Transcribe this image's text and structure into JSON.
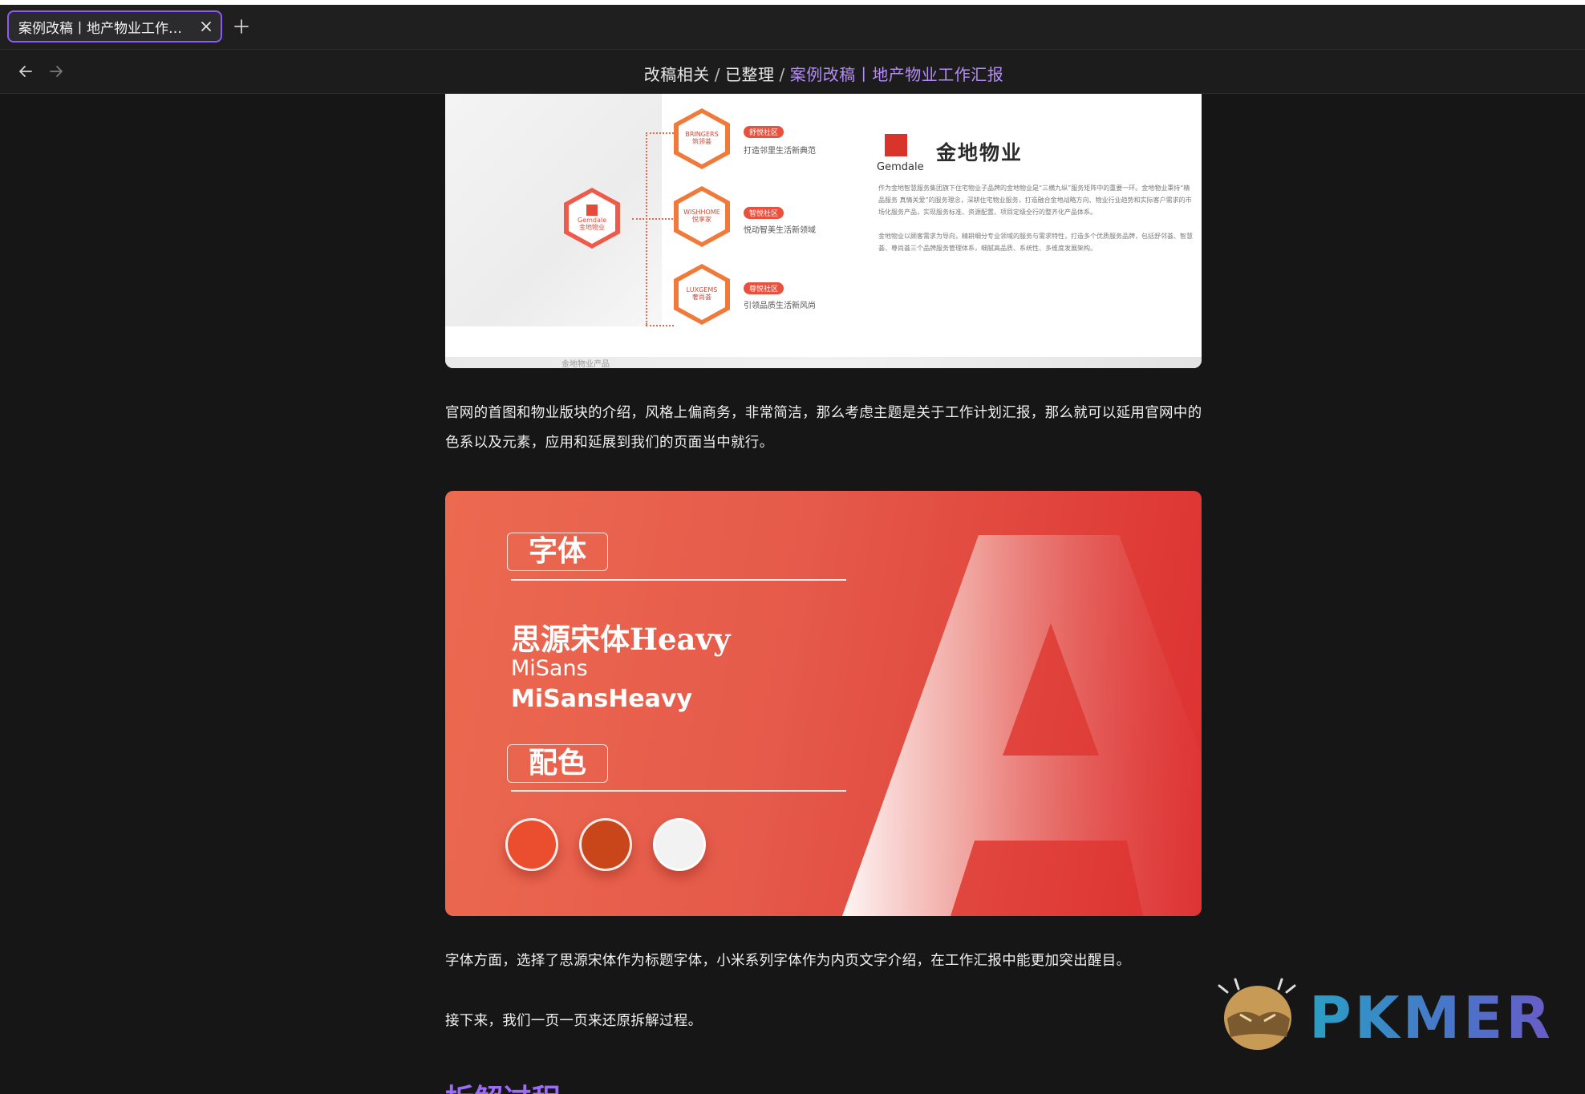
{
  "tab": {
    "title": "案例改稿丨地产物业工作汇报"
  },
  "breadcrumb": {
    "items": [
      "改稿相关",
      "已整理"
    ],
    "separator": "/",
    "current": "案例改稿丨地产物业工作汇报"
  },
  "image1": {
    "main_hex": {
      "line1": "Gemdale",
      "line2": "金地物业"
    },
    "brands": [
      {
        "logo": "BRINGERS",
        "sub": "筑领荟",
        "badge": "舒悦社区",
        "slogan": "打造邻里生活新典范"
      },
      {
        "logo": "WISHHOME",
        "sub": "悦享家",
        "badge": "智悦社区",
        "slogan": "悦动智美生活新领域"
      },
      {
        "logo": "LUXGEMS",
        "sub": "奢尚荟",
        "badge": "尊悦社区",
        "slogan": "引领品质生活新风尚"
      }
    ],
    "company_brand": "Gemdale",
    "company_name": "金地物业",
    "para1": "作为金地智慧服务集团旗下住宅物业子品牌的金地物业是“三横九纵”服务矩阵中的重要一环。金地物业秉持“精品服务 真情关爱”的服务理念，深耕住宅物业服务，打造融合金地战略方向、物业行业趋势和实际客户需求的市场化服务产品，实现服务标准、资源配置、项目定级全行的整齐化产品体系。",
    "para2": "金地物业以顾客需求为导向，精耕细分专业领域的服务与需求特性，打造多个优质服务品牌，包括舒邻荟、智慧荟、尊尚荟三个品牌服务管理体系，细腻高品质、系统性、多维度发展架构。",
    "caption": "金地物业产品"
  },
  "paragraphs": {
    "p1": "官网的首图和物业版块的介绍，风格上偏商务，非常简洁，那么考虑主题是关于工作计划汇报，那么就可以延用官网中的色系以及元素，应用和延展到我们的页面当中就行。",
    "p2": "字体方面，选择了思源宋体作为标题字体，小米系列字体作为内页文字介绍，在工作汇报中能更加突出醒目。",
    "p3": "接下来，我们一页一页来还原拆解过程。"
  },
  "image2": {
    "font_label": "字体",
    "fonts": [
      "思源宋体Heavy",
      "MiSans",
      "MiSansHeavy"
    ],
    "color_label": "配色",
    "swatches": [
      "#ea4e2e",
      "#c9461a",
      "#f2f2f2"
    ]
  },
  "section_heading": "拆解过程",
  "watermark": {
    "text": "PKMER"
  },
  "colors": {
    "accent": "#8a5cf5",
    "crumb_current": "#b58cf7",
    "heading": "#9c6cf6",
    "brand_red": "#e0483a"
  }
}
